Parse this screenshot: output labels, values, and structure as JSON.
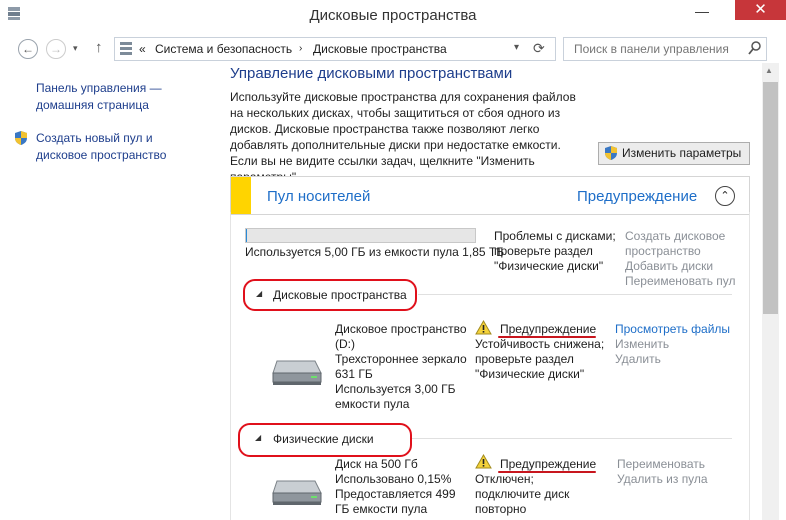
{
  "window": {
    "title": "Дисковые пространства",
    "minimize": "—",
    "close": "✕"
  },
  "address": {
    "prefix": "«",
    "crumbs": [
      "Система и безопасность",
      "Дисковые пространства"
    ],
    "search_placeholder": "Поиск в панели управления"
  },
  "sidebar": {
    "home_link": "Панель управления — домашняя страница",
    "create_link": "Создать новый пул и дисковое пространство"
  },
  "main": {
    "title": "Управление дисковыми пространствами",
    "description": "Используйте дисковые пространства для сохранения файлов на нескольких дисках, чтобы защититься от сбоя одного из дисков. Дисковые пространства также позволяют легко добавлять дополнительные диски при недостатке емкости. Если вы не видите ссылки задач, щелкните \"Изменить параметры\".",
    "change_settings_button": "Изменить параметры"
  },
  "pool": {
    "title": "Пул носителей",
    "status": "Предупреждение",
    "usage_text": "Используется 5,00 ГБ из емкости пула 1,85 ТБ",
    "usage_fraction": 0.003,
    "problem_text": "Проблемы с дисками; проверьте раздел \"Физические диски\"",
    "actions": [
      "Создать дисковое пространство",
      "Добавить диски",
      "Переименовать пул"
    ]
  },
  "spaces_section": {
    "title": "Дисковые пространства",
    "item": {
      "name": "Дисковое пространство (D:)",
      "layout": "Трехстороннее зеркало 631 ГБ",
      "used": "Используется 3,00 ГБ емкости пула",
      "status_title": "Предупреждение",
      "status_detail": "Устойчивость снижена; проверьте раздел \"Физические диски\"",
      "actions": [
        "Просмотреть файлы",
        "Изменить",
        "Удалить"
      ]
    }
  },
  "disks_section": {
    "title": "Физические диски",
    "item": {
      "name": "Диск на 500 Гб",
      "used": "Использовано 0,15%",
      "provided": "Предоставляется 499 ГБ емкости пула",
      "status_title": "Предупреждение",
      "status_detail": "Отключен; подключите диск повторно",
      "actions": [
        "Переименовать",
        "Удалить из пула"
      ]
    }
  },
  "colors": {
    "link_blue": "#1e6ec8",
    "warning_yellow": "#ffd400",
    "annotation_red": "#e0101b"
  }
}
